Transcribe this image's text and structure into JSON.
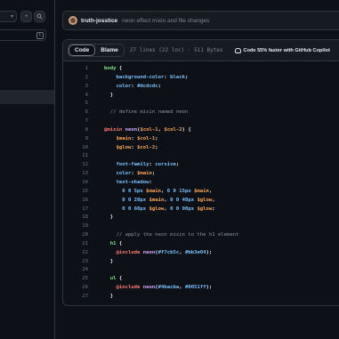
{
  "sidebar": {
    "branch_caret": "▾",
    "add_button_label": "+",
    "search_button_icon": "search-icon",
    "filter_shortcut": "t"
  },
  "commit_header": {
    "author": "truth-josstice",
    "message": "neon effect mixin and file changes"
  },
  "file_toolbar": {
    "code_tab": "Code",
    "blame_tab": "Blame",
    "file_meta": "27 lines (22 loc) · 511 Bytes",
    "copilot_text": "Code 55% faster with GitHub Copilot"
  },
  "code_lines": [
    {
      "n": "1",
      "tokens": [
        [
          "sel",
          "body"
        ],
        [
          "pl",
          " {"
        ]
      ]
    },
    {
      "n": "2",
      "tokens": [
        [
          "prop",
          "    background-color"
        ],
        [
          "pl",
          ": "
        ],
        [
          "val",
          "black"
        ],
        [
          "pl",
          ";"
        ]
      ]
    },
    {
      "n": "3",
      "tokens": [
        [
          "prop",
          "    color"
        ],
        [
          "pl",
          ": "
        ],
        [
          "val",
          "#dcdcdc"
        ],
        [
          "pl",
          ";"
        ]
      ]
    },
    {
      "n": "4",
      "tokens": [
        [
          "pl",
          "  }"
        ]
      ]
    },
    {
      "n": "5",
      "tokens": []
    },
    {
      "n": "6",
      "tokens": [
        [
          "cm",
          "  // define mixin named neon"
        ]
      ]
    },
    {
      "n": "7",
      "tokens": []
    },
    {
      "n": "8",
      "tokens": [
        [
          "at",
          "@mixin"
        ],
        [
          "pl",
          " "
        ],
        [
          "fn",
          "neon"
        ],
        [
          "pl",
          "("
        ],
        [
          "var",
          "$col-1"
        ],
        [
          "pl",
          ", "
        ],
        [
          "var",
          "$col-2"
        ],
        [
          "pl",
          ") {"
        ]
      ]
    },
    {
      "n": "9",
      "tokens": [
        [
          "var",
          "    $main"
        ],
        [
          "pl",
          ": "
        ],
        [
          "var",
          "$col-1"
        ],
        [
          "pl",
          ";"
        ]
      ]
    },
    {
      "n": "10",
      "tokens": [
        [
          "var",
          "    $glow"
        ],
        [
          "pl",
          ": "
        ],
        [
          "var",
          "$col-2"
        ],
        [
          "pl",
          ";"
        ]
      ]
    },
    {
      "n": "11",
      "tokens": []
    },
    {
      "n": "12",
      "tokens": [
        [
          "prop",
          "    font-family"
        ],
        [
          "pl",
          ": "
        ],
        [
          "val",
          "cursive"
        ],
        [
          "pl",
          ";"
        ]
      ]
    },
    {
      "n": "13",
      "tokens": [
        [
          "prop",
          "    color"
        ],
        [
          "pl",
          ": "
        ],
        [
          "var",
          "$main"
        ],
        [
          "pl",
          ";"
        ]
      ]
    },
    {
      "n": "14",
      "tokens": [
        [
          "prop",
          "    text-shadow"
        ],
        [
          "pl",
          ":"
        ]
      ]
    },
    {
      "n": "15",
      "tokens": [
        [
          "val",
          "      0 0 5px "
        ],
        [
          "var",
          "$main"
        ],
        [
          "pl",
          ", "
        ],
        [
          "val",
          "0 0 15px "
        ],
        [
          "var",
          "$main"
        ],
        [
          "pl",
          ","
        ]
      ]
    },
    {
      "n": "16",
      "tokens": [
        [
          "val",
          "      0 0 20px "
        ],
        [
          "var",
          "$main"
        ],
        [
          "pl",
          ", "
        ],
        [
          "val",
          "0 0 40px "
        ],
        [
          "var",
          "$glow"
        ],
        [
          "pl",
          ","
        ]
      ]
    },
    {
      "n": "17",
      "tokens": [
        [
          "val",
          "      0 0 60px "
        ],
        [
          "var",
          "$glow"
        ],
        [
          "pl",
          ", "
        ],
        [
          "val",
          "0 0 90px "
        ],
        [
          "var",
          "$glow"
        ],
        [
          "pl",
          ";"
        ]
      ]
    },
    {
      "n": "18",
      "tokens": [
        [
          "pl",
          "  }"
        ]
      ]
    },
    {
      "n": "19",
      "tokens": []
    },
    {
      "n": "20",
      "tokens": [
        [
          "cm",
          "    // apply the neon mixin to the h1 element"
        ]
      ]
    },
    {
      "n": "21",
      "tokens": [
        [
          "sel",
          "  h1"
        ],
        [
          "pl",
          " {"
        ]
      ]
    },
    {
      "n": "22",
      "tokens": [
        [
          "at",
          "    @include"
        ],
        [
          "pl",
          " "
        ],
        [
          "fn",
          "neon"
        ],
        [
          "pl",
          "("
        ],
        [
          "val",
          "#f7cb5c"
        ],
        [
          "pl",
          ", "
        ],
        [
          "val",
          "#bb3e04"
        ],
        [
          "pl",
          ");"
        ]
      ]
    },
    {
      "n": "23",
      "tokens": [
        [
          "pl",
          "  }"
        ]
      ]
    },
    {
      "n": "24",
      "tokens": []
    },
    {
      "n": "25",
      "tokens": [
        [
          "sel",
          "  ul"
        ],
        [
          "pl",
          " {"
        ]
      ]
    },
    {
      "n": "26",
      "tokens": [
        [
          "at",
          "    @include"
        ],
        [
          "pl",
          " "
        ],
        [
          "fn",
          "neon"
        ],
        [
          "pl",
          "("
        ],
        [
          "val",
          "#4bacba"
        ],
        [
          "pl",
          ", "
        ],
        [
          "val",
          "#0051ff"
        ],
        [
          "pl",
          ");"
        ]
      ]
    },
    {
      "n": "27",
      "tokens": [
        [
          "pl",
          "  }"
        ]
      ]
    }
  ]
}
